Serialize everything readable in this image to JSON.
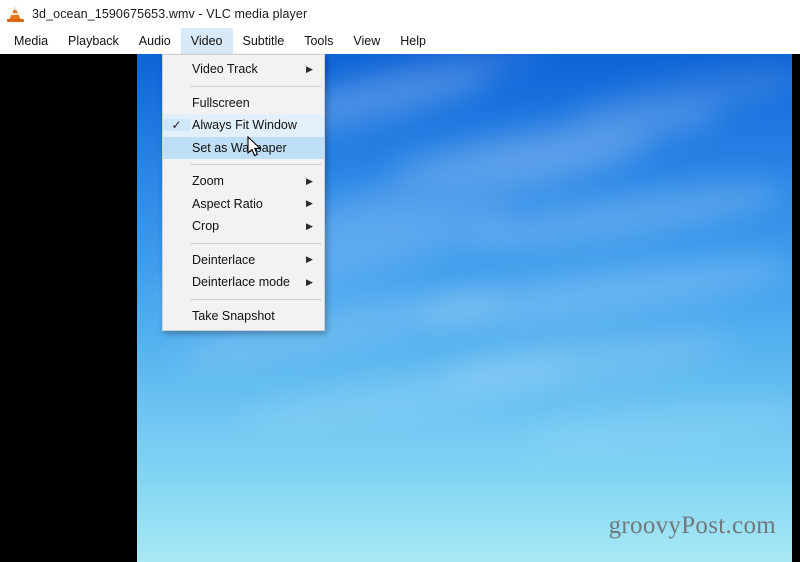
{
  "window": {
    "title": "3d_ocean_1590675653.wmv - VLC media player",
    "app_icon": "vlc-cone-icon"
  },
  "menubar": {
    "items": [
      {
        "label": "Media",
        "active": false
      },
      {
        "label": "Playback",
        "active": false
      },
      {
        "label": "Audio",
        "active": false
      },
      {
        "label": "Video",
        "active": true
      },
      {
        "label": "Subtitle",
        "active": false
      },
      {
        "label": "Tools",
        "active": false
      },
      {
        "label": "View",
        "active": false
      },
      {
        "label": "Help",
        "active": false
      }
    ],
    "active_highlight_color": "#d8eaf7"
  },
  "video_menu": {
    "entries": [
      {
        "type": "item",
        "label": "Video Track",
        "submenu": true,
        "checked": false,
        "highlighted": false
      },
      {
        "type": "separator"
      },
      {
        "type": "item",
        "label": "Fullscreen",
        "submenu": false,
        "checked": false,
        "highlighted": false
      },
      {
        "type": "item",
        "label": "Always Fit Window",
        "submenu": false,
        "checked": true,
        "highlighted": false
      },
      {
        "type": "item",
        "label": "Set as Wallpaper",
        "submenu": false,
        "checked": false,
        "highlighted": true
      },
      {
        "type": "separator"
      },
      {
        "type": "item",
        "label": "Zoom",
        "submenu": true,
        "checked": false,
        "highlighted": false
      },
      {
        "type": "item",
        "label": "Aspect Ratio",
        "submenu": true,
        "checked": false,
        "highlighted": false
      },
      {
        "type": "item",
        "label": "Crop",
        "submenu": true,
        "checked": false,
        "highlighted": false
      },
      {
        "type": "separator"
      },
      {
        "type": "item",
        "label": "Deinterlace",
        "submenu": true,
        "checked": false,
        "highlighted": false
      },
      {
        "type": "item",
        "label": "Deinterlace mode",
        "submenu": true,
        "checked": false,
        "highlighted": false
      },
      {
        "type": "separator"
      },
      {
        "type": "item",
        "label": "Take Snapshot",
        "submenu": false,
        "checked": false,
        "highlighted": false
      }
    ],
    "check_glyph": "✓",
    "submenu_glyph": "▶",
    "highlight_color": "#bfdff7",
    "background_color": "#f2f2f2"
  },
  "video": {
    "watermark": "groovyPost.com",
    "letterbox_color": "#000000",
    "sky_top_color": "#0f63d6",
    "sky_bottom_color": "#a8e8f2"
  },
  "cursor": {
    "type": "arrow-pointer"
  }
}
